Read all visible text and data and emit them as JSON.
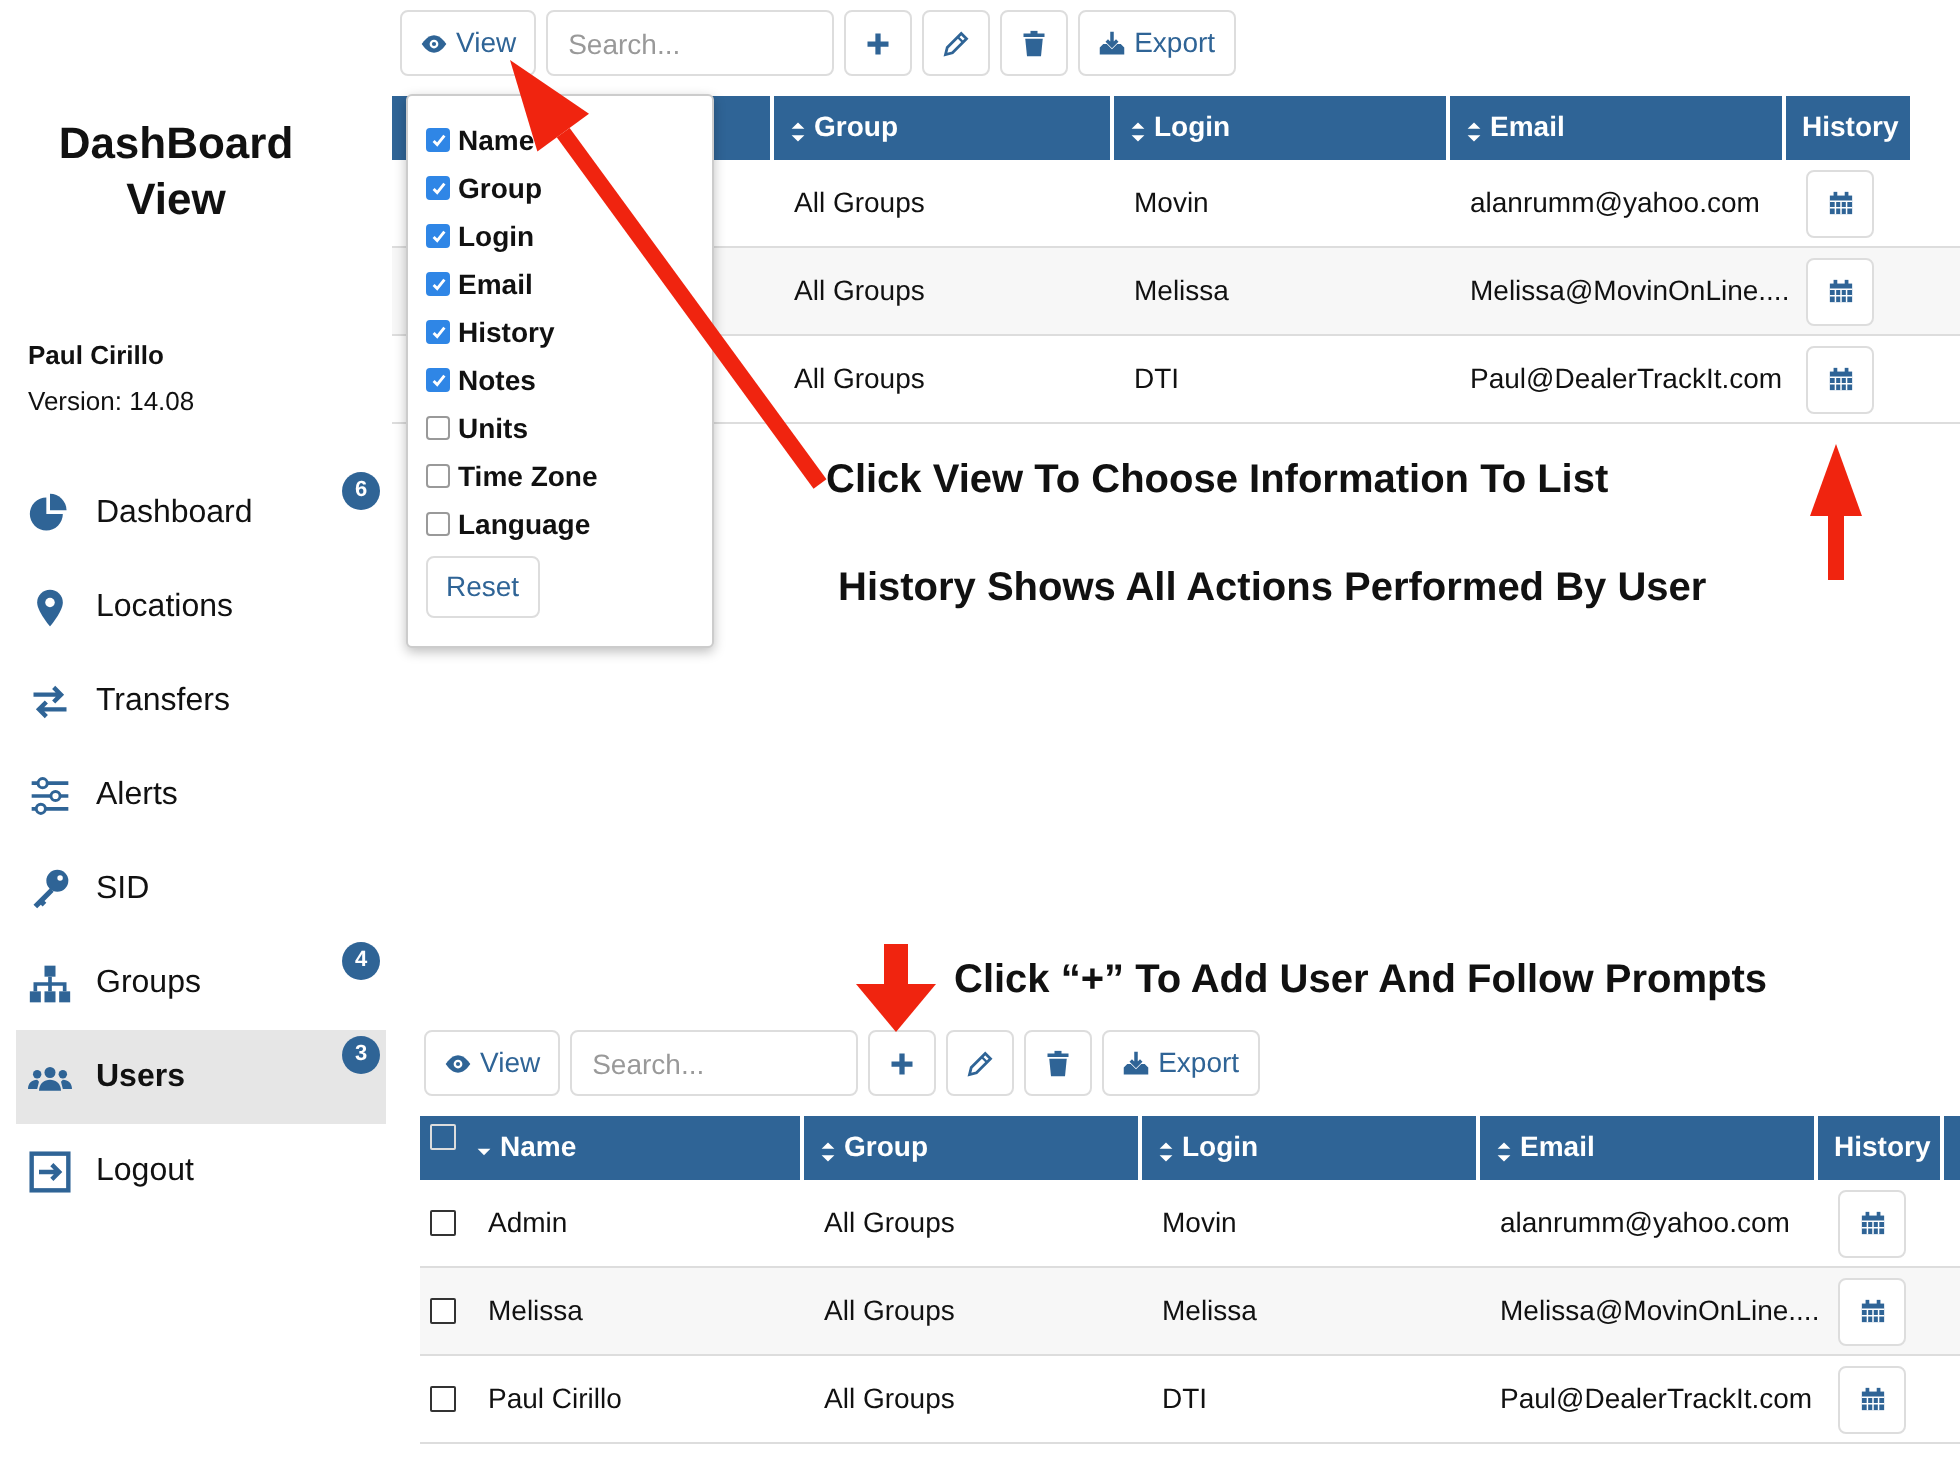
{
  "sidebar": {
    "title": "DashBoard View",
    "user_name": "Paul Cirillo",
    "version": "Version: 14.08",
    "items": [
      {
        "label": "Dashboard",
        "badge": "6",
        "selected": false
      },
      {
        "label": "Locations",
        "selected": false
      },
      {
        "label": "Transfers",
        "selected": false
      },
      {
        "label": "Alerts",
        "selected": false
      },
      {
        "label": "SID",
        "selected": false
      },
      {
        "label": "Groups",
        "badge": "4",
        "selected": false
      },
      {
        "label": "Users",
        "badge": "3",
        "selected": true
      },
      {
        "label": "Logout",
        "selected": false
      }
    ]
  },
  "top_panel": {
    "toolbar": {
      "view_label": "View",
      "search_placeholder": "Search...",
      "export_label": "Export"
    },
    "view_menu": {
      "options": [
        {
          "label": "Name",
          "checked": true
        },
        {
          "label": "Group",
          "checked": true
        },
        {
          "label": "Login",
          "checked": true
        },
        {
          "label": "Email",
          "checked": true
        },
        {
          "label": "History",
          "checked": true
        },
        {
          "label": "Notes",
          "checked": true
        },
        {
          "label": "Units",
          "checked": false
        },
        {
          "label": "Time Zone",
          "checked": false
        },
        {
          "label": "Language",
          "checked": false
        }
      ],
      "reset_label": "Reset"
    },
    "table": {
      "columns": [
        {
          "label": "Group",
          "sortable": true,
          "sorted": false
        },
        {
          "label": "Login",
          "sortable": true,
          "sorted": false
        },
        {
          "label": "Email",
          "sortable": true,
          "sorted": false
        },
        {
          "label": "History",
          "sortable": false,
          "sorted": false
        }
      ],
      "rows": [
        {
          "cells": [
            "All Groups",
            "Movin",
            "alanrumm@yahoo.com"
          ]
        },
        {
          "cells": [
            "All Groups",
            "Melissa",
            "Melissa@MovinOnLine...."
          ]
        },
        {
          "cells": [
            "All Groups",
            "DTI",
            "Paul@DealerTrackIt.com"
          ]
        }
      ]
    }
  },
  "annotations": [
    {
      "text": "Click View To Choose Information To List"
    },
    {
      "text": "History Shows All Actions Performed By User"
    },
    {
      "text": "Click “+” To Add User And Follow Prompts"
    }
  ],
  "bottom_panel": {
    "toolbar": {
      "view_label": "View",
      "search_placeholder": "Search...",
      "export_label": "Export"
    },
    "table": {
      "select_all_checked": false,
      "columns": [
        {
          "label": "Name",
          "sortable": true,
          "sorted": true
        },
        {
          "label": "Group",
          "sortable": true,
          "sorted": false
        },
        {
          "label": "Login",
          "sortable": true,
          "sorted": false
        },
        {
          "label": "Email",
          "sortable": true,
          "sorted": false
        },
        {
          "label": "History",
          "sortable": false,
          "sorted": false
        }
      ],
      "rows": [
        {
          "selected": false,
          "cells": [
            "Admin",
            "All Groups",
            "Movin",
            "alanrumm@yahoo.com"
          ]
        },
        {
          "selected": false,
          "cells": [
            "Melissa",
            "All Groups",
            "Melissa",
            "Melissa@MovinOnLine...."
          ]
        },
        {
          "selected": false,
          "cells": [
            "Paul Cirillo",
            "All Groups",
            "DTI",
            "Paul@DealerTrackIt.com"
          ]
        }
      ]
    }
  }
}
